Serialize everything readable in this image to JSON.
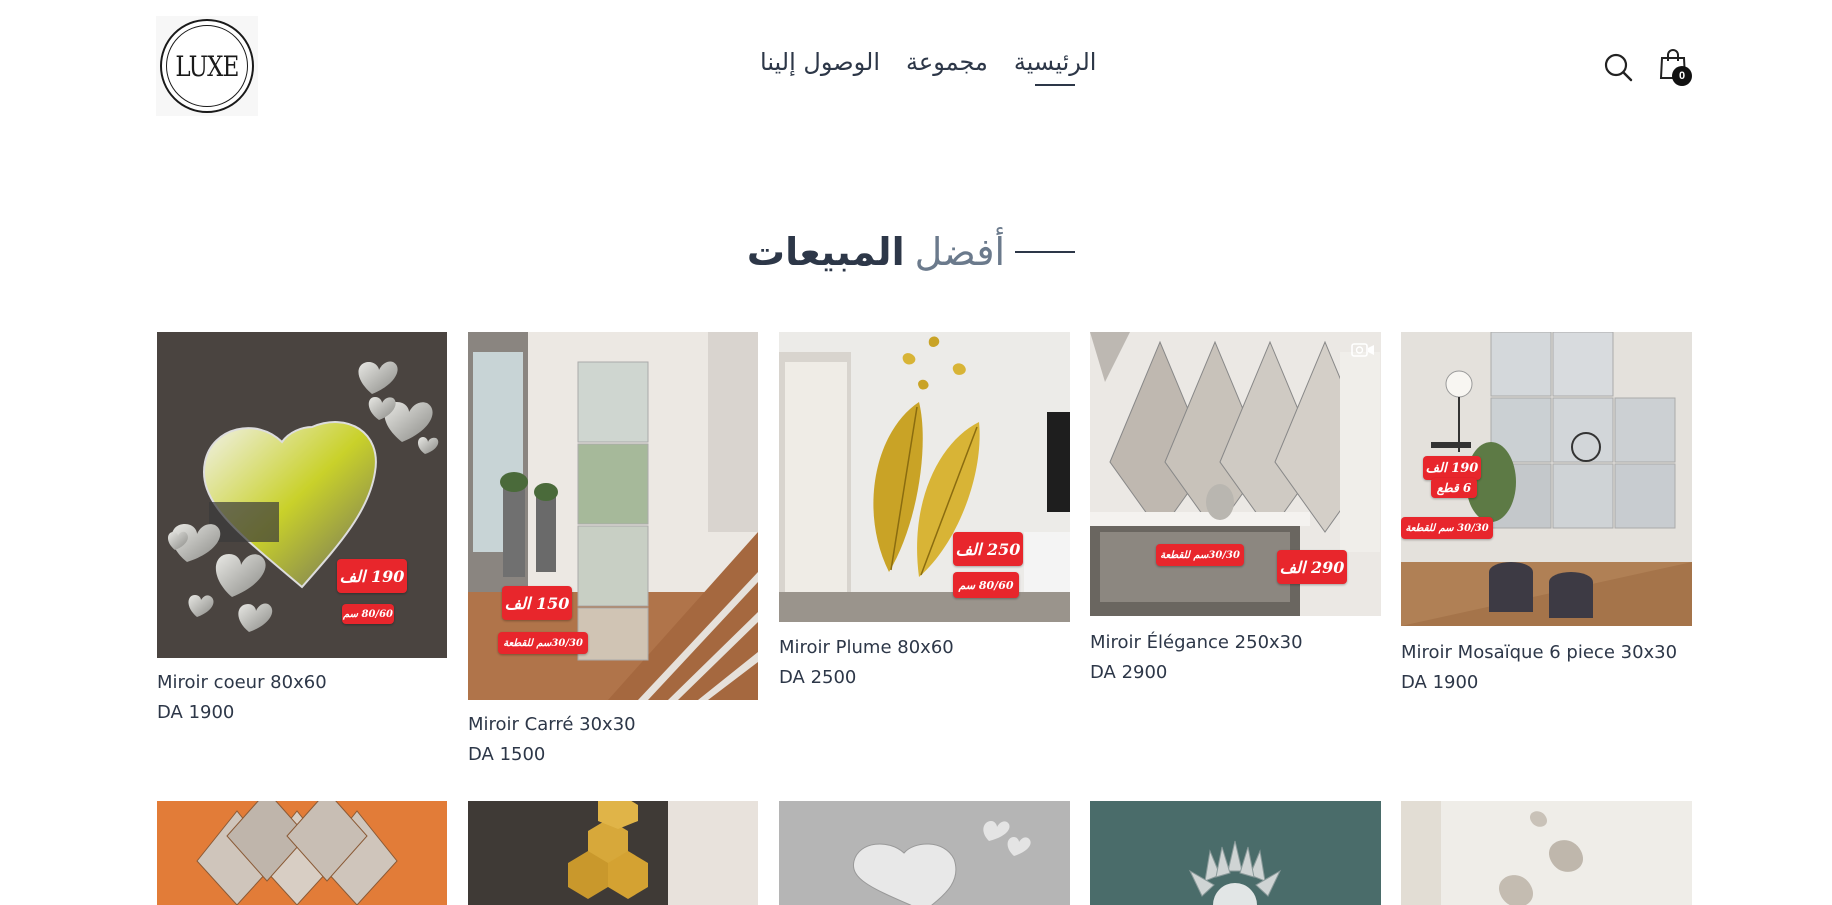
{
  "header": {
    "logo_text": "LUXE",
    "nav": [
      {
        "label": "الرئيسية",
        "active": true
      },
      {
        "label": "مجموعة",
        "active": false
      },
      {
        "label": "الوصول إلينا",
        "active": false
      }
    ],
    "cart_count": "0",
    "icons": {
      "search": "search-icon",
      "cart": "shopping-bag-icon"
    }
  },
  "section": {
    "title_light": "أفضل",
    "title_bold": "المبيعات"
  },
  "products": [
    {
      "title": "Miroir coeur 80x60",
      "price": "DA 1900",
      "tag_price": "190 الف",
      "tag_size": "80/60 سم"
    },
    {
      "title": "Miroir Carré 30x30",
      "price": "DA 1500",
      "tag_price": "150 الف",
      "tag_size": "30/30سم للقطعة"
    },
    {
      "title": "Miroir Plume 80x60",
      "price": "DA 2500",
      "tag_price": "250 الف",
      "tag_size": "80/60 سم"
    },
    {
      "title": "Miroir Élégance 250x30",
      "price": "DA 2900",
      "tag_price": "290 الف",
      "tag_size": "30/30سم للقطعة"
    },
    {
      "title": "Miroir Mosaïque 6 piece 30x30",
      "price": "DA 1900",
      "tag_price": "190 الف",
      "tag_pieces": "6 قطع",
      "tag_size": "30/30 سم للقطعة"
    }
  ],
  "colors": {
    "accent_red": "#e8262c",
    "text": "#2d3748",
    "muted": "#6b7a8c"
  }
}
